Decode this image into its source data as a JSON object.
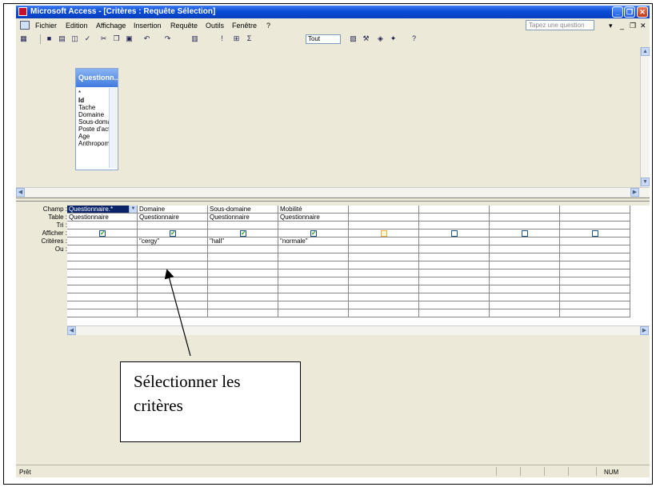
{
  "window": {
    "title": "Microsoft Access - [Critères : Requête Sélection]",
    "minimize_glyph": "_",
    "maximize_glyph": "❐",
    "close_glyph": "✕"
  },
  "menu": {
    "items": [
      "Fichier",
      "Edition",
      "Affichage",
      "Insertion",
      "Requête",
      "Outils",
      "Fenêtre",
      "?"
    ],
    "question_placeholder": "Tapez une question",
    "controls": [
      "▾",
      "_",
      "❐",
      "✕"
    ]
  },
  "toolbar": {
    "select_value": "Tout",
    "icons": [
      "view-icon",
      "save-icon",
      "print-icon",
      "preview-icon",
      "spell-icon",
      "cut-icon",
      "copy-icon",
      "paste-icon",
      "undo-icon",
      "redo-icon",
      "query-type-icon",
      "run-icon",
      "show-table-icon",
      "totals-icon",
      "properties-icon",
      "build-icon",
      "database-window-icon",
      "new-object-icon",
      "help-icon"
    ]
  },
  "table_box": {
    "title": "Questionn...",
    "fields": [
      "*",
      "Id",
      "Tache",
      "Domaine",
      "Sous-domaine",
      "Poste d'activit",
      "Age",
      "Anthropométr"
    ]
  },
  "grid": {
    "row_labels": [
      "Champ :",
      "Table :",
      "Tri :",
      "Afficher :",
      "Critères :",
      "Ou :"
    ],
    "columns": [
      {
        "champ": "Questionnaire.*",
        "table": "Questionnaire",
        "tri": "",
        "afficher": true,
        "criteres": "",
        "ou": ""
      },
      {
        "champ": "Domaine",
        "table": "Questionnaire",
        "tri": "",
        "afficher": true,
        "criteres": "\"cergy\"",
        "ou": ""
      },
      {
        "champ": "Sous-domaine",
        "table": "Questionnaire",
        "tri": "",
        "afficher": true,
        "criteres": "\"hall\"",
        "ou": ""
      },
      {
        "champ": "Mobilité",
        "table": "Questionnaire",
        "tri": "",
        "afficher": true,
        "criteres": "\"normale\"",
        "ou": ""
      },
      {
        "champ": "",
        "table": "",
        "tri": "",
        "afficher": false,
        "criteres": "",
        "ou": ""
      },
      {
        "champ": "",
        "table": "",
        "tri": "",
        "afficher": false,
        "criteres": "",
        "ou": ""
      },
      {
        "champ": "",
        "table": "",
        "tri": "",
        "afficher": false,
        "criteres": "",
        "ou": ""
      },
      {
        "champ": "",
        "table": "",
        "tri": "",
        "afficher": false,
        "criteres": "",
        "ou": ""
      }
    ]
  },
  "callout": {
    "line1": "Sélectionner les",
    "line2": "critères"
  },
  "status": {
    "ready": "Prêt",
    "num": "NUM"
  },
  "colors": {
    "titlebar": "#0a4bd6",
    "background": "#ece9d8",
    "selection": "#0a246a",
    "checkmark": "#21a121"
  }
}
